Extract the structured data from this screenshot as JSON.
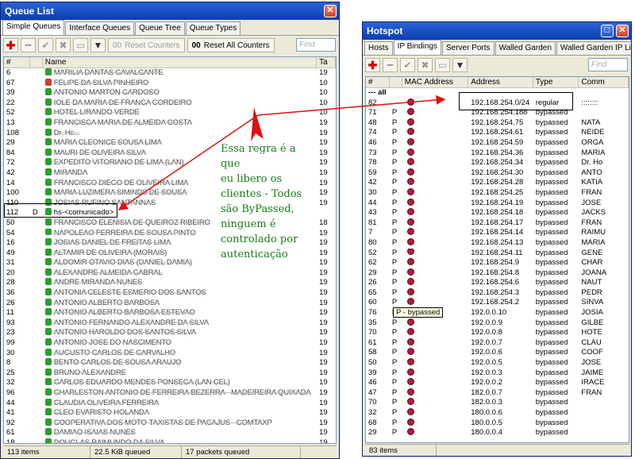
{
  "queue_window": {
    "title": "Queue List",
    "tabs": [
      "Simple Queues",
      "Interface Queues",
      "Queue Tree",
      "Queue Types"
    ],
    "reset_counters": "Reset Counters",
    "reset_all_counters": "Reset All Counters",
    "find_placeholder": "Find",
    "columns": [
      "#",
      "",
      "Name",
      "Ta"
    ],
    "rows": [
      {
        "n": "6",
        "f": "",
        "name": "MARILIA DANTAS CAVALCANTE",
        "t": "19",
        "red": false
      },
      {
        "n": "67",
        "f": "",
        "name": "FELIPE DA SILVA PINHEIRO",
        "t": "10",
        "red": true
      },
      {
        "n": "39",
        "f": "",
        "name": "ANTONIO MARTON CARDOSO",
        "t": "10",
        "red": false
      },
      {
        "n": "22",
        "f": "",
        "name": "IOLE DA MARIA DE FRANCA CORDEIRO",
        "t": "10",
        "red": false
      },
      {
        "n": "52",
        "f": "",
        "name": "HOTEL LIRANDO VERDE",
        "t": "10",
        "red": false
      },
      {
        "n": "13",
        "f": "",
        "name": "FRANCISCA MARIA DE ALMEIDA COSTA",
        "t": "19",
        "red": false
      },
      {
        "n": "108",
        "f": "",
        "name": "Dr. Hc...",
        "t": "19",
        "red": false
      },
      {
        "n": "29",
        "f": "",
        "name": "MARIA CLEONICE SOUSA LIMA",
        "t": "19",
        "red": false
      },
      {
        "n": "84",
        "f": "",
        "name": "MAURI DE OLIVEIRA SILVA",
        "t": "19",
        "red": false
      },
      {
        "n": "72",
        "f": "",
        "name": "EXPEDITO VITORIANO DE LIMA (LAN)",
        "t": "19",
        "red": false
      },
      {
        "n": "42",
        "f": "",
        "name": "MIRANDA",
        "t": "19",
        "red": false
      },
      {
        "n": "14",
        "f": "",
        "name": "FRANCISCO DIEGO DE OLIVEIRA LIMA",
        "t": "19",
        "red": false
      },
      {
        "n": "100",
        "f": "",
        "name": "MARIA LUZIMERA SIMINDS DE SOUSA",
        "t": "19",
        "red": false
      },
      {
        "n": "110",
        "f": "",
        "name": "JOSIAS RUFINO SANTANNAS",
        "t": "19",
        "red": false
      },
      {
        "n": "112",
        "f": "D",
        "name": "hs-<comunicado>",
        "t": "",
        "red": false
      },
      {
        "n": "50",
        "f": "",
        "name": "FRANCISCO ELENISIA DE QUEIROZ RIBEIRO",
        "t": "18",
        "red": false
      },
      {
        "n": "54",
        "f": "",
        "name": "NAPOLEAO FERREIRA DE SOUSA PINTO",
        "t": "19",
        "red": false
      },
      {
        "n": "16",
        "f": "",
        "name": "JOSIAS DANIEL DE FREITAS LIMA",
        "t": "19",
        "red": false
      },
      {
        "n": "49",
        "f": "",
        "name": "ALTAMIR DE OLIVEIRA (MORAIS)",
        "t": "19",
        "red": false
      },
      {
        "n": "31",
        "f": "",
        "name": "ALDOMIR OTAVIO DIAS (DANIEL DAMIA)",
        "t": "19",
        "red": false
      },
      {
        "n": "20",
        "f": "",
        "name": "ALEXANDRE ALMEIDA CABRAL",
        "t": "19",
        "red": false
      },
      {
        "n": "28",
        "f": "",
        "name": "ANDRE MIRANDA NUNES",
        "t": "19",
        "red": false
      },
      {
        "n": "36",
        "f": "",
        "name": "ANTONIA CELESTE ESMERIO DOS SANTOS",
        "t": "19",
        "red": false
      },
      {
        "n": "26",
        "f": "",
        "name": "ANTONIO ALBERTO BARBOSA",
        "t": "19",
        "red": false
      },
      {
        "n": "11",
        "f": "",
        "name": "ANTONIO ALBERTO BARBOSA ESTEVAO",
        "t": "19",
        "red": false
      },
      {
        "n": "93",
        "f": "",
        "name": "ANTONIO FERNANDO ALEXANDRE DA SILVA",
        "t": "19",
        "red": false
      },
      {
        "n": "23",
        "f": "",
        "name": "ANTONIO HAROLDO DOS SANTOS SILVA",
        "t": "19",
        "red": false
      },
      {
        "n": "99",
        "f": "",
        "name": "ANTONIO JOSE DO NASCIMENTO",
        "t": "19",
        "red": false
      },
      {
        "n": "30",
        "f": "",
        "name": "AUGUSTO CARLOS DE CARVALHO",
        "t": "19",
        "red": false
      },
      {
        "n": "8",
        "f": "",
        "name": "BENTO CARLOS DE SOUSA ARAUJO",
        "t": "19",
        "red": false
      },
      {
        "n": "25",
        "f": "",
        "name": "BRUNO ALEXANDRE",
        "t": "19",
        "red": false
      },
      {
        "n": "32",
        "f": "",
        "name": "CARLOS EDUARDO MENDES PONSECA (LAN CEL)",
        "t": "19",
        "red": false
      },
      {
        "n": "96",
        "f": "",
        "name": "CHARLESTON ANTONIO DE FERREIRA BEZERRA - MADEIREIRA QUIXADA",
        "t": "19",
        "red": false
      },
      {
        "n": "44",
        "f": "",
        "name": "CLAUDIA OLIVEIRA FERREIRA",
        "t": "19",
        "red": false
      },
      {
        "n": "41",
        "f": "",
        "name": "CLEO EVARISTO HOLANDA",
        "t": "19",
        "red": false
      },
      {
        "n": "92",
        "f": "",
        "name": "COOPERATIVA DOS MOTO-TAXISTAS DE PACAJUS - COMTAXP",
        "t": "19",
        "red": false
      },
      {
        "n": "61",
        "f": "",
        "name": "DAMIAO ISAIAS NUNES",
        "t": "19",
        "red": false
      },
      {
        "n": "18",
        "f": "",
        "name": "DOUGLAS RAIMUNDO DA SILVA",
        "t": "19",
        "red": false
      }
    ],
    "status": [
      "113 items",
      "22.5 KiB queued",
      "17 packets queued"
    ]
  },
  "hotspot_window": {
    "title": "Hotspot",
    "tabs": [
      "Hosts",
      "IP Bindings",
      "Server Ports",
      "Walled Garden",
      "Walled Garden IP List"
    ],
    "find_placeholder": "Find",
    "columns": [
      "#",
      "",
      "MAC Address",
      "Address",
      "Type",
      "Comm"
    ],
    "group_label": "--- all",
    "rows": [
      {
        "n": "82",
        "f": "",
        "addr": "192.168.254.0/24",
        "type": "regular",
        "c": "::::::::"
      },
      {
        "n": "71",
        "f": "P",
        "addr": "192.168.254.188",
        "type": "bypassed",
        "c": ""
      },
      {
        "n": "48",
        "f": "P",
        "addr": "192.168.254.75",
        "type": "bypassed",
        "c": "NATA"
      },
      {
        "n": "74",
        "f": "P",
        "addr": "192.168.254.61",
        "type": "bypassed",
        "c": "NEIDE"
      },
      {
        "n": "46",
        "f": "P",
        "addr": "192.168.254.59",
        "type": "bypassed",
        "c": "ORGA"
      },
      {
        "n": "73",
        "f": "P",
        "addr": "192.168.254.36",
        "type": "bypassed",
        "c": "MARIA"
      },
      {
        "n": "78",
        "f": "P",
        "addr": "192.168.254.34",
        "type": "bypassed",
        "c": "Dr. Ho"
      },
      {
        "n": "59",
        "f": "P",
        "addr": "192.168.254.30",
        "type": "bypassed",
        "c": "ANTO"
      },
      {
        "n": "42",
        "f": "P",
        "addr": "192.168.254.28",
        "type": "bypassed",
        "c": "KATIA"
      },
      {
        "n": "30",
        "f": "P",
        "addr": "192.168.254.25",
        "type": "bypassed",
        "c": "FRAN"
      },
      {
        "n": "44",
        "f": "P",
        "addr": "192.168.254.19",
        "type": "bypassed",
        "c": "JOSE"
      },
      {
        "n": "43",
        "f": "P",
        "addr": "192.168.254.18",
        "type": "bypassed",
        "c": "JACKS"
      },
      {
        "n": "81",
        "f": "P",
        "addr": "192.168.254.17",
        "type": "bypassed",
        "c": "FRAN"
      },
      {
        "n": "7",
        "f": "P",
        "addr": "192.168.254.14",
        "type": "bypassed",
        "c": "RAIMU"
      },
      {
        "n": "80",
        "f": "P",
        "addr": "192.168.254.13",
        "type": "bypassed",
        "c": "MARIA"
      },
      {
        "n": "52",
        "f": "P",
        "addr": "192.168.254.11",
        "type": "bypassed",
        "c": "GENE"
      },
      {
        "n": "62",
        "f": "P",
        "addr": "192.168.254.9",
        "type": "bypassed",
        "c": "CHAR"
      },
      {
        "n": "29",
        "f": "P",
        "addr": "192.168.254.8",
        "type": "bypassed",
        "c": "JOANA"
      },
      {
        "n": "26",
        "f": "P",
        "addr": "192.168.254.6",
        "type": "bypassed",
        "c": "NAUT"
      },
      {
        "n": "65",
        "f": "P",
        "addr": "192.168.254.3",
        "type": "bypassed",
        "c": "PEDR"
      },
      {
        "n": "60",
        "f": "P",
        "addr": "192.168.254.2",
        "type": "bypassed",
        "c": "SINVA"
      },
      {
        "n": "76",
        "f": "P",
        "addr": "192.0.0.10",
        "type": "bypassed",
        "c": "JOSIA"
      },
      {
        "n": "35",
        "f": "P",
        "addr": "192.0.0.9",
        "type": "bypassed",
        "c": "GILBE"
      },
      {
        "n": "70",
        "f": "P",
        "addr": "192.0.0.8",
        "type": "bypassed",
        "c": "HOTE"
      },
      {
        "n": "61",
        "f": "P",
        "addr": "192.0.0.7",
        "type": "bypassed",
        "c": "CLAU"
      },
      {
        "n": "58",
        "f": "P",
        "addr": "192.0.0.6",
        "type": "bypassed",
        "c": "COOF"
      },
      {
        "n": "50",
        "f": "P",
        "addr": "192.0.0.5",
        "type": "bypassed",
        "c": "JOSE"
      },
      {
        "n": "39",
        "f": "P",
        "addr": "192.0.0.3",
        "type": "bypassed",
        "c": "JAIME"
      },
      {
        "n": "46",
        "f": "P",
        "addr": "192.0.0.2",
        "type": "bypassed",
        "c": "IRACE"
      },
      {
        "n": "47",
        "f": "P",
        "addr": "182.0.0.7",
        "type": "bypassed",
        "c": "FRAN"
      },
      {
        "n": "70",
        "f": "P",
        "addr": "182.0.0.3",
        "type": "bypassed",
        "c": ""
      },
      {
        "n": "32",
        "f": "P",
        "addr": "180.0.0.6",
        "type": "bypassed",
        "c": ""
      },
      {
        "n": "68",
        "f": "P",
        "addr": "180.0.0.5",
        "type": "bypassed",
        "c": ""
      },
      {
        "n": "29",
        "f": "P",
        "addr": "180.0.0.4",
        "type": "bypassed",
        "c": ""
      }
    ],
    "tooltip": "P - bypassed",
    "status": [
      "83 items"
    ]
  },
  "annotation": {
    "text_lines": [
      "Essa regra é a que",
      "eu libero os",
      "clientes - Todos",
      "são ByPassed,",
      "ninguem é",
      "controlado por",
      "autenticação"
    ],
    "color": "#1a7a1a",
    "arrow_color": "#e01010"
  }
}
